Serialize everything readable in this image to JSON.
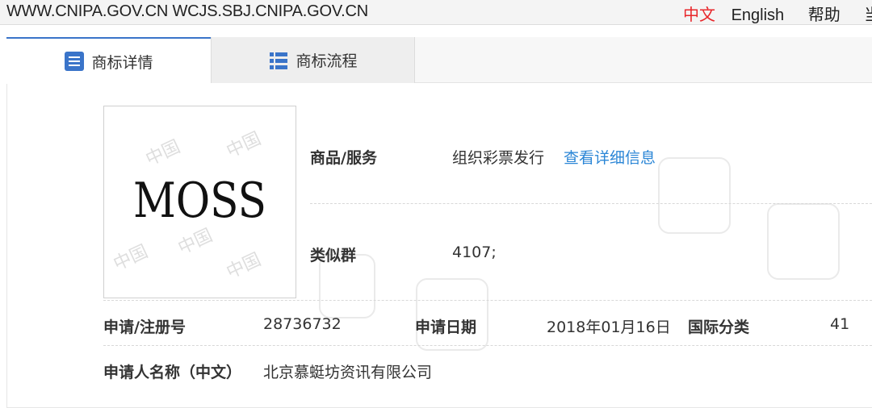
{
  "topbar": {
    "sites": "WWW.CNIPA.GOV.CN WCJS.SBJ.CNIPA.GOV.CN",
    "links": [
      "中文",
      "English",
      "帮助",
      "当"
    ],
    "active_color": "#e8262a"
  },
  "tabs": [
    {
      "label": "商标详情",
      "icon": "document-list-icon"
    },
    {
      "label": "商标流程",
      "icon": "bullet-list-icon"
    }
  ],
  "trademark": {
    "image_text": "MOSS",
    "watermark_text": "中国"
  },
  "details": {
    "goods_label": "商品/服务",
    "goods_value": "组织彩票发行",
    "goods_link": "查看详细信息",
    "similar_group_label": "类似群",
    "similar_group_value": "4107;",
    "reg_no_label": "申请/注册号",
    "reg_no_value": "28736732",
    "apply_date_label": "申请日期",
    "apply_date_value": "2018年01月16日",
    "intl_class_label": "国际分类",
    "intl_class_value": "41",
    "applicant_label": "申请人名称（中文）",
    "applicant_value": "北京慕蜓坊资讯有限公司"
  },
  "colors": {
    "link": "#2b86d6",
    "tab_accent": "#3a74c9"
  }
}
